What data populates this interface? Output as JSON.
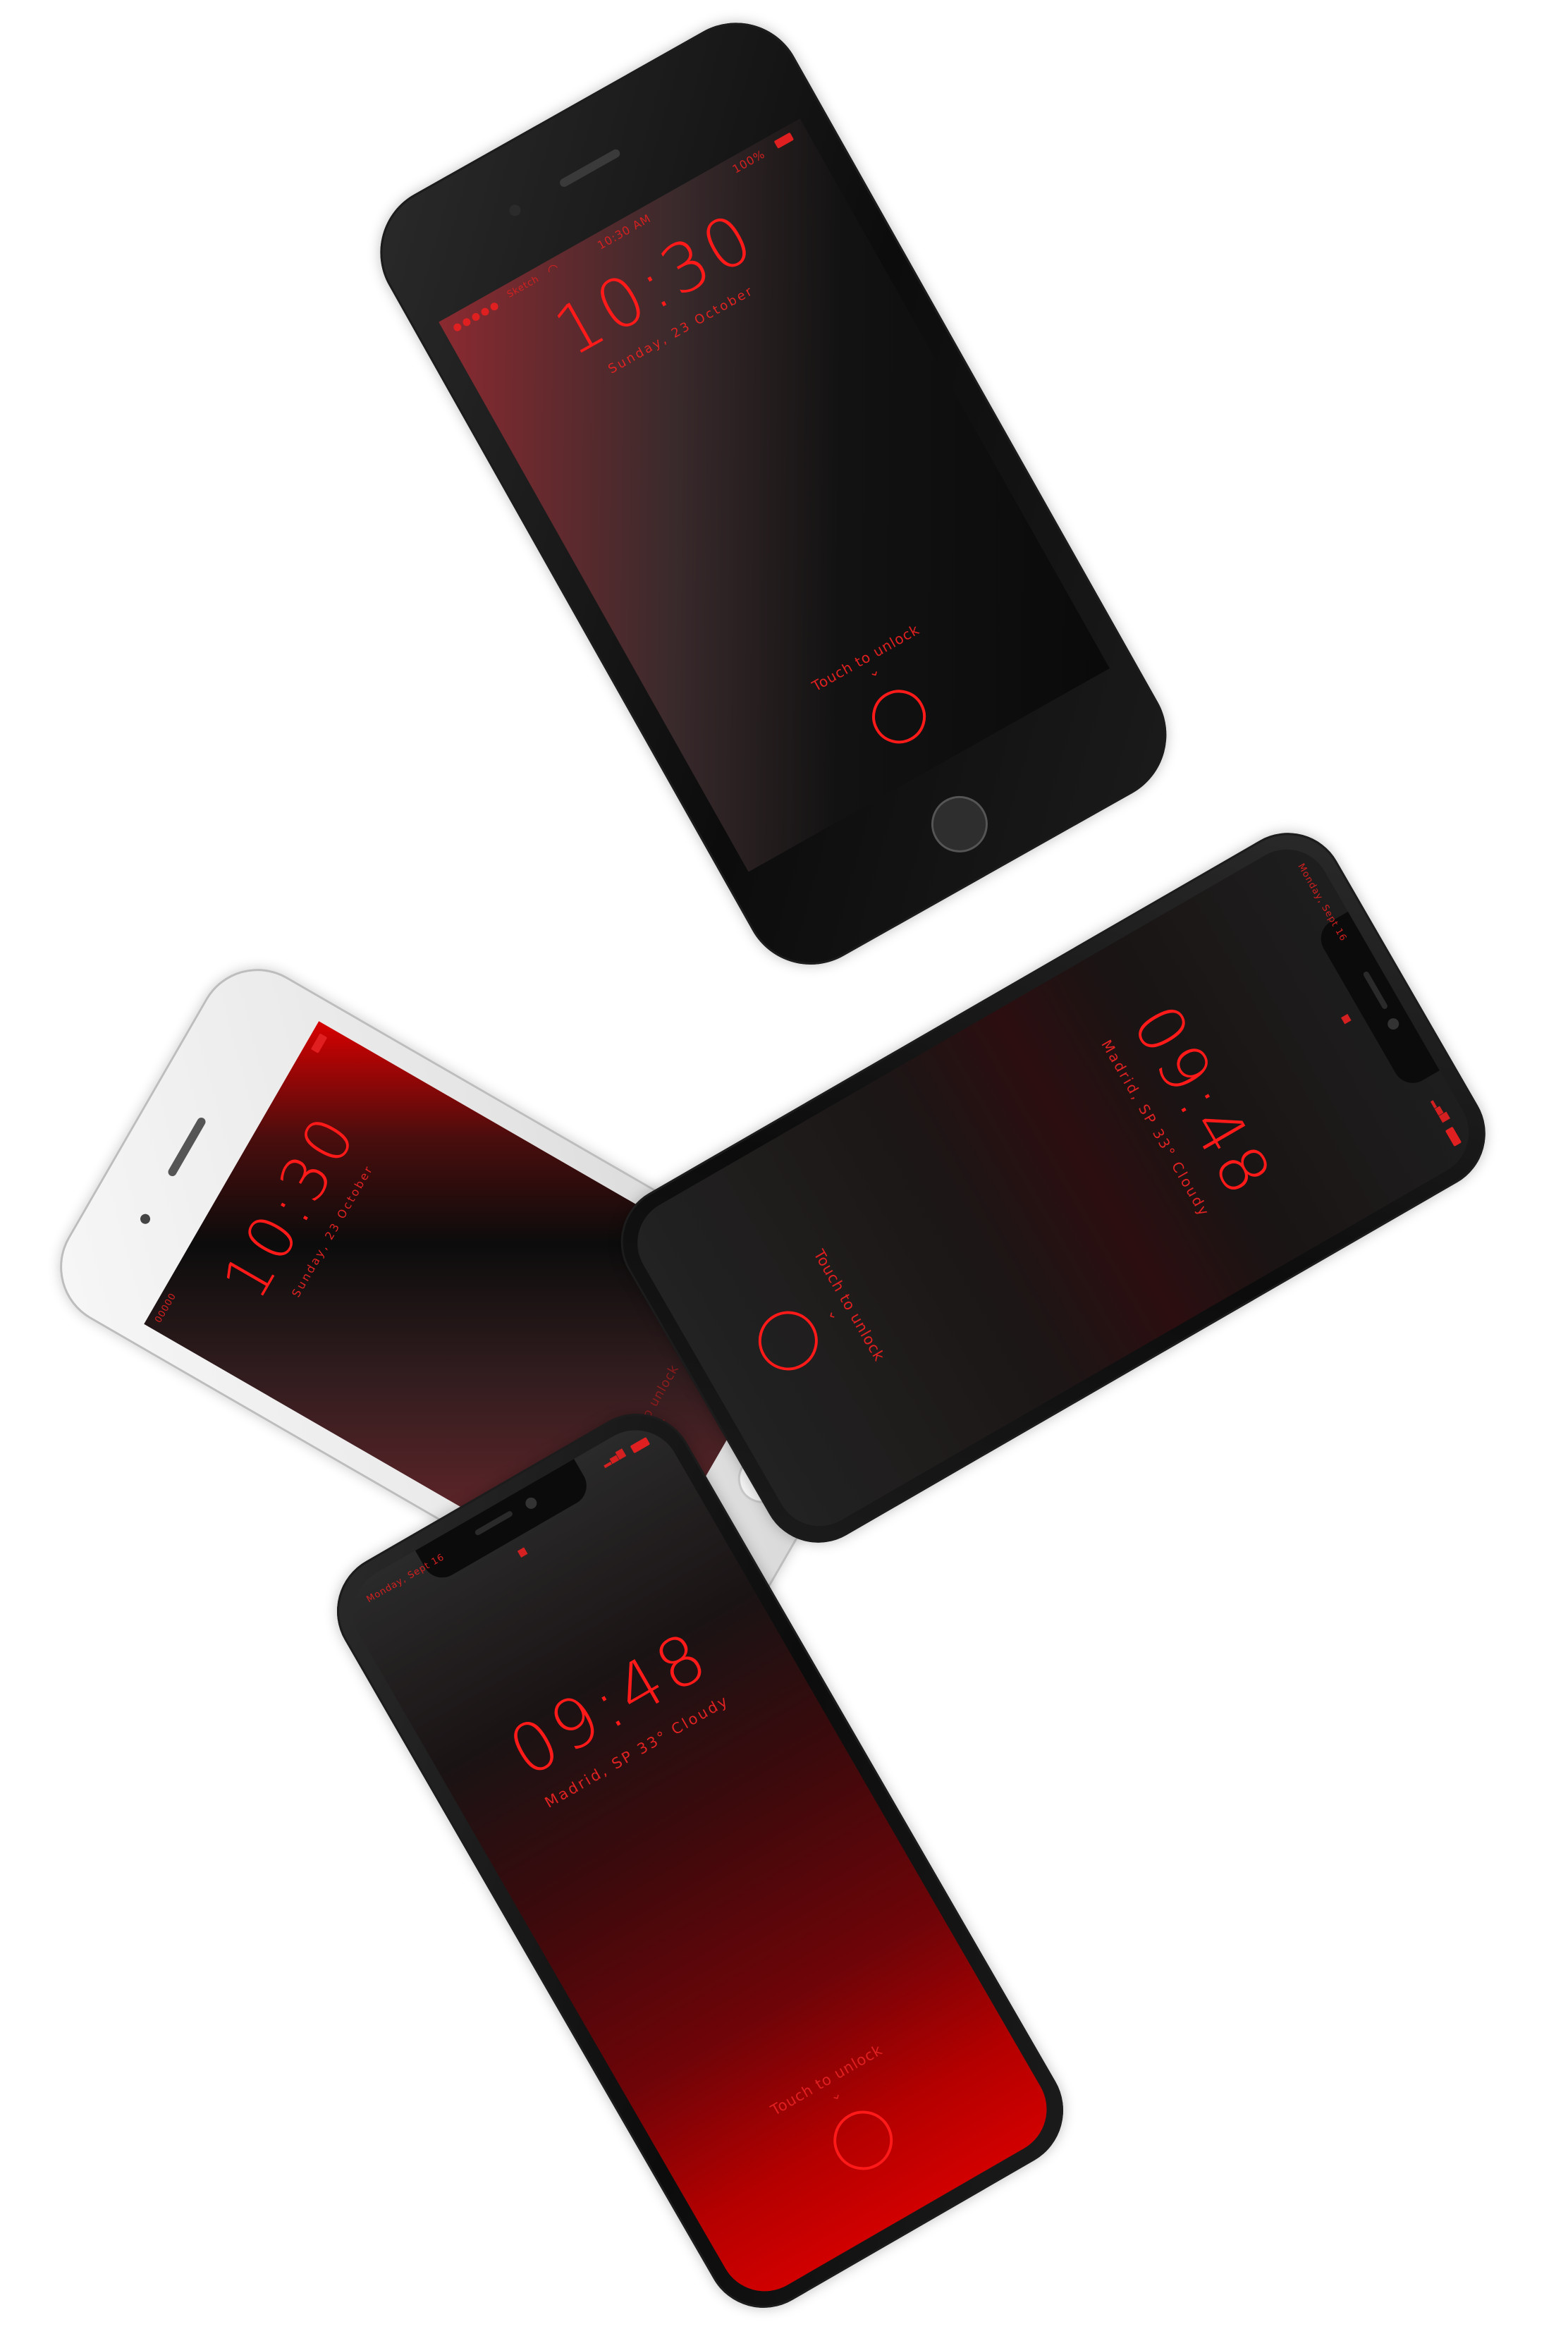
{
  "phones": {
    "top": {
      "carrier": "Sketch",
      "time_status": "10:30 AM",
      "battery_status": "100%",
      "clock": "10:30",
      "date": "Sunday, 23 October",
      "touch": "Touch to unlock",
      "chevron": "⌄"
    },
    "white": {
      "status": "00000",
      "clock": "10:30",
      "date": "Sunday, 23 October",
      "touch": "Touch to unlock",
      "chevron": "⌄"
    },
    "landscape_x": {
      "date_status": "Monday, Sept 16",
      "clock": "09:48",
      "weather": "Madrid, SP 33° Cloudy",
      "touch": "Touch to unlock",
      "chevron": "⌄"
    },
    "bottom_x": {
      "date_status": "Monday, Sept 16",
      "clock": "09:48",
      "weather": "Madrid, SP 33° Cloudy",
      "touch": "Touch to unlock",
      "chevron": "⌄"
    }
  },
  "colors": {
    "accent_red": "#ff1a1a",
    "background": "#ffffff",
    "phone_black": "#0c0c0c",
    "phone_white": "#eeeeee"
  }
}
